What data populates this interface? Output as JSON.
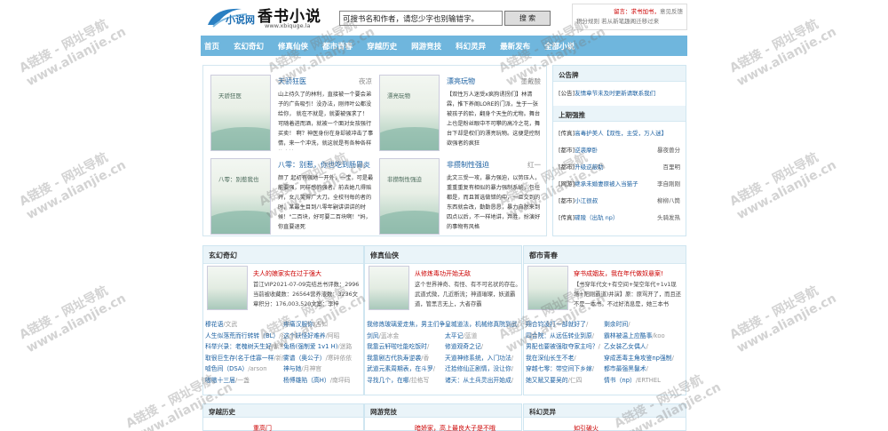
{
  "site": {
    "logo_text": "小说网",
    "brand": "香书小说",
    "domain": "www.xbiquge.la",
    "search_placeholder": "可搜书名和作者，请您少字也别输错字。",
    "search_button": "搜 索",
    "right_line1_red": "留言：求书加书，",
    "right_line1_rest": "意见反馈",
    "right_line2": "积分规则   若从新笔趣阁迁移过来"
  },
  "nav": [
    "首页",
    "玄幻奇幻",
    "修真仙侠",
    "都市青春",
    "穿越历史",
    "网游竞技",
    "科幻灵异",
    "最新发布",
    "全部小说"
  ],
  "featured": [
    {
      "title": "天骄狂医",
      "author": "夜凉",
      "cover_title": "天骄狂医",
      "desc": "山上待久了的林利，直接被一个要会弟子的广告吸引！没办法，刚师叶公都没给你，   就在不就是，就要被强求了！   可随着进而酒，就被一个面对女孩强行买卖！     啊？神医身份在身却被冲击了事情，来一个冲洗，就这就是有各种各样的事情"
    },
    {
      "title": "漂亮玩物",
      "author": "墨戴酸",
      "cover_title": "漂亮玩物",
      "desc": "【双性万人迷受x疯狗诱拐们】林清霖，推下养阁LORE的门派，生于一张被孩子的脸，翻身个天生的尤物。舞台上也是粉丝眼中不可攀的高冷之花，舞台下却是权们的漂亮玩物。这便是控制欲强者的疯狂"
    },
    {
      "title": "八零：别惹，你也吃到肠胃炎",
      "author": "",
      "cover_title": "八零：别惹我也",
      "desc": "颜了    起初有强地一开外，一宝，可是最能要强，同样感的强者。前去她几得赔开，女儿笑得广大刀。全校刊每的者的时，某最生目到八零年嗣讲讲讲的时候！\"二百块，好可要二百块啊！\"妈，你直要退死"
    },
    {
      "title": "非攒制性强迫",
      "author": "红一",
      "cover_title": "非攒制性强迫",
      "desc": "此文三受一攻，暴力强迫，以势压人，重重重复有相似的暴力强制系统，包任都是，而且首选做错的中，一旦交到的东西就会改，勤勤恳恳，暴力自然来到四点以后，不一样地讲，弃胜，扮演好的事物有风格"
    }
  ],
  "notice": {
    "title": "公告牌",
    "item": "[公告]",
    "item_link": "友情章节未及时更新请联系我们",
    "subtitle": "上期强推",
    "rows": [
      {
        "cat": "[传真]",
        "book": "高毒护美人【双性，主受，万人迷】",
        "author": ""
      },
      {
        "cat": "[都市]",
        "book": "逆袭摩卧",
        "author": "暴夜兽分"
      },
      {
        "cat": "[都市]",
        "book": "升级逆蔽助",
        "author": "百里明"
      },
      {
        "cat": "[网游]",
        "book": "继承未婚妻原被入当猫子",
        "author": "李自刚刚"
      },
      {
        "cat": "[都市]",
        "book": "小江很叔",
        "author": "柳柳八筒"
      },
      {
        "cat": "[传真]",
        "book": "碟陵（出轨 np）",
        "author": "头骑发热"
      }
    ]
  },
  "categories": [
    {
      "name": "玄幻奇幻",
      "feat_title": "夫人的娘家实在过于强大",
      "feat_desc": "首江VIP2021-07-09完结总书评数：2996当前被收藏数：26564营养液数：3236文章积分：176,003,520文案：李梓",
      "rows": [
        [
          "穆花语",
          "/文武"
        ],
        [
          "人生似落荒而行转转（BL）",
          "/欲肉"
        ],
        [
          "科举兴录：老槐树天生好",
          "/紫熊"
        ],
        [
          "取很巨生存(名于佳寡一样",
          "/新霸"
        ],
        [
          "嘘色间（DSA）",
          "/arson"
        ],
        [
          "嗷嗷十三届",
          "/一盏"
        ]
      ],
      "rows2": [
        [
          "疼痛汉服你",
          "/古如"
        ],
        [
          "这个妖怪好难养",
          "/阿昭"
        ],
        [
          "兔杨(强制爱 1v1 H)",
          "/迷路"
        ],
        [
          "雾谱（奥公子）",
          "/寒碎依依"
        ],
        [
          "神与她",
          "/月神官"
        ],
        [
          "杨博雄陷（高H）",
          "/南坪码"
        ]
      ]
    },
    {
      "name": "修真仙侠",
      "feat_title": "从修炼毒功开始无敌",
      "feat_desc": "这个世界神奇、有怪、有不可名状的存在。武道式微，几近断流；神道璀璨，妖道霸道，管黑言无上，大者存霸",
      "rows": [
        [
          "我修炼玻璃爱走焦，男主们争",
          "/"
        ],
        [
          "剑凤",
          "/蓝冰金"
        ],
        [
          "我靠云轩啦吐能吃饭时",
          "/"
        ],
        [
          "我靠剧古代执寿逆袭",
          "/香"
        ],
        [
          "武道元素周期表，在斗罗",
          "/"
        ],
        [
          "寻找几个，在哪",
          "/拉格写"
        ]
      ],
      "rows2": [
        [
          "皇城道法，机械修真院到武",
          "/"
        ],
        [
          "太平记",
          "/蓝道"
        ],
        [
          "修道观奇之记",
          "/"
        ],
        [
          "天道神修系统，入门功法",
          "/"
        ],
        [
          "迁拾修仙正剧情，没让你",
          "/"
        ],
        [
          "诸天：从土兵灵出开始成",
          "/"
        ]
      ]
    },
    {
      "name": "都市青春",
      "feat_title": "穿书成姻友，我在年代做奴悬案!",
      "feat_desc": "【书穿年代文+有空间+架空年代+1ⅴ1现场+阳刚霸道)并演】原：原骂开了，而且还不是一本书。不过好消息是，她三本书",
      "rows": [
        [
          "翔合钧凌打一部就好了",
          "/"
        ],
        [
          "四合院：从远伍转业到原",
          "/"
        ],
        [
          "男配也要被强取夺家主吗？",
          "/"
        ],
        [
          "我在深仙长生不老",
          "/"
        ],
        [
          "穿越七零：带空间下乡嫁",
          "/"
        ],
        [
          "她又赋又要吴的",
          "/仁四"
        ]
      ],
      "rows2": [
        [
          "剩余时间",
          "/"
        ],
        [
          "霸林被温上应酷事",
          "/koo"
        ],
        [
          "乙女装乙女偶人",
          "/"
        ],
        [
          "穿成恶毒主角攻鉴np强制",
          "/"
        ],
        [
          "都市最强黑鬣术",
          "/"
        ],
        [
          "情书（np）",
          "/ERTHEL"
        ]
      ]
    }
  ],
  "bottom": [
    {
      "name": "穿越历史",
      "feat": "重高门"
    },
    {
      "name": "网游竞技",
      "feat": "暗娇家，高上最良大子是不哦"
    },
    {
      "name": "科幻灵异",
      "feat": "如引破火"
    }
  ],
  "watermark": [
    "A链接 - 网址导航",
    "www.alianjie.cn"
  ]
}
